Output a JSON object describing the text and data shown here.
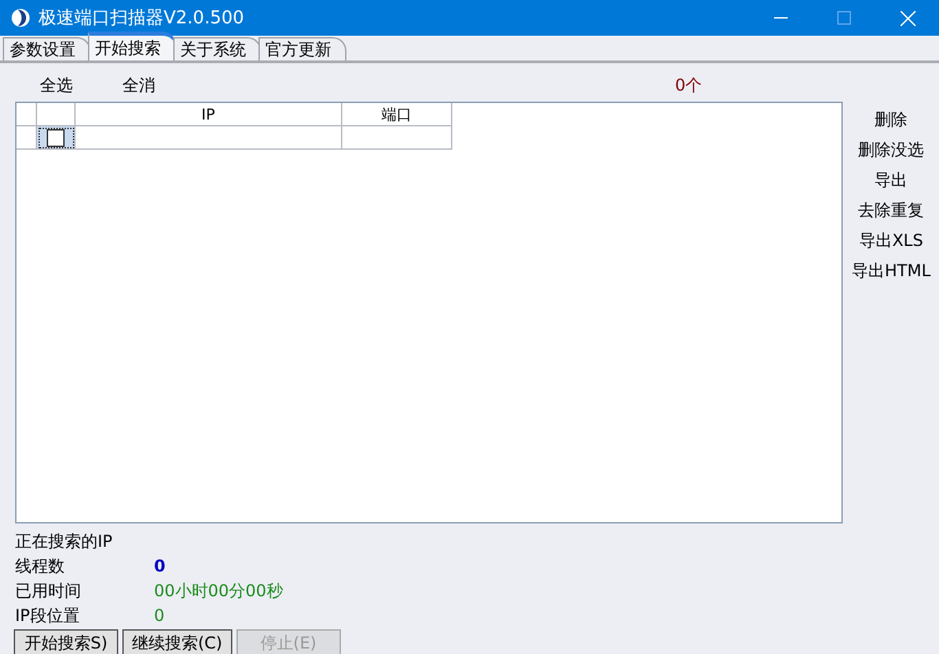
{
  "window": {
    "title": "极速端口扫描器V2.0.500"
  },
  "tabs": [
    {
      "label": "参数设置",
      "selected": false
    },
    {
      "label": "开始搜索",
      "selected": true
    },
    {
      "label": "关于系统",
      "selected": false
    },
    {
      "label": "官方更新",
      "selected": false
    }
  ],
  "toolbar": {
    "select_all": "全选",
    "deselect_all": "全消",
    "count": "0个"
  },
  "table": {
    "columns": [
      "IP",
      "端口"
    ],
    "rows": [
      {
        "checked": false
      }
    ]
  },
  "side_actions": [
    "删除",
    "删除没选",
    "导出",
    "去除重复",
    "导出XLS",
    "导出HTML"
  ],
  "status": {
    "searching_label": "正在搜索的IP",
    "fields": [
      {
        "label": "线程数",
        "value": "0",
        "kind": "count"
      },
      {
        "label": "已用时间",
        "value": "00小时00分00秒",
        "kind": "time"
      },
      {
        "label": "IP段位置",
        "value": "0",
        "kind": "time"
      }
    ]
  },
  "buttons": [
    {
      "label": "开始搜索S)",
      "disabled": false
    },
    {
      "label": "继续搜索(C)",
      "disabled": false
    },
    {
      "label": "停止(E)",
      "disabled": true
    }
  ]
}
